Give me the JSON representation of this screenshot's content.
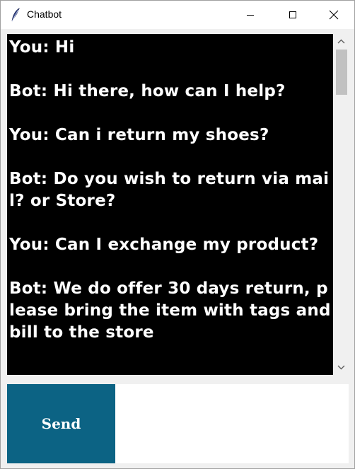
{
  "window": {
    "title": "Chatbot",
    "icon": "feather-icon"
  },
  "chat": {
    "messages": [
      {
        "text": "You: Hi"
      },
      {
        "text": "Bot: Hi there, how can I help?"
      },
      {
        "text": "You: Can i return my shoes?"
      },
      {
        "text": "Bot: Do you wish to return via mail? or Store?"
      },
      {
        "text": "You: Can I exchange my product?"
      },
      {
        "text": "Bot: We do offer 30 days return, please bring the item with tags and bill to the store"
      }
    ]
  },
  "controls": {
    "send_label": "Send",
    "input_value": ""
  },
  "colors": {
    "chat_background": "#000000",
    "chat_text": "#ffffff",
    "send_button": "#0c6384"
  }
}
